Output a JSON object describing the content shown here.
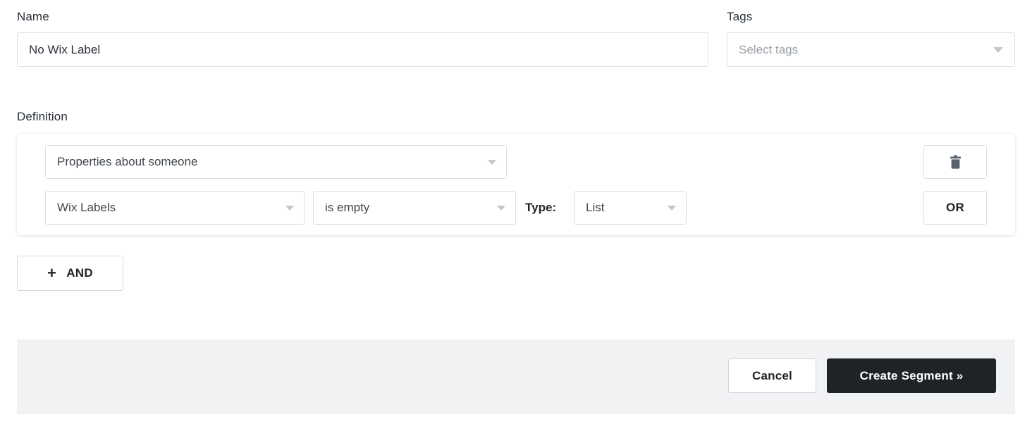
{
  "form": {
    "name": {
      "label": "Name",
      "value": "No Wix Label"
    },
    "tags": {
      "label": "Tags",
      "placeholder": "Select tags",
      "value": "Select tags"
    },
    "definition": {
      "label": "Definition",
      "rows": [
        {
          "property_group": "Properties about someone",
          "field": "Wix Labels",
          "operator": "is empty",
          "type_label": "Type:",
          "type_value": "List",
          "delete_icon": "trash-icon",
          "conjunction_button": "OR"
        }
      ],
      "add_group": {
        "icon": "plus-icon",
        "plus": "+",
        "label": "AND"
      }
    }
  },
  "footer": {
    "cancel_label": "Cancel",
    "submit_label": "Create Segment »"
  },
  "colors": {
    "footer_background": "#f1f2f4",
    "primary_button_background": "#1f2227",
    "border": "#dcdfe3",
    "placeholder_text": "#9aa0a6",
    "caret": "#c2c7cd",
    "trash_icon": "#5a636d"
  }
}
